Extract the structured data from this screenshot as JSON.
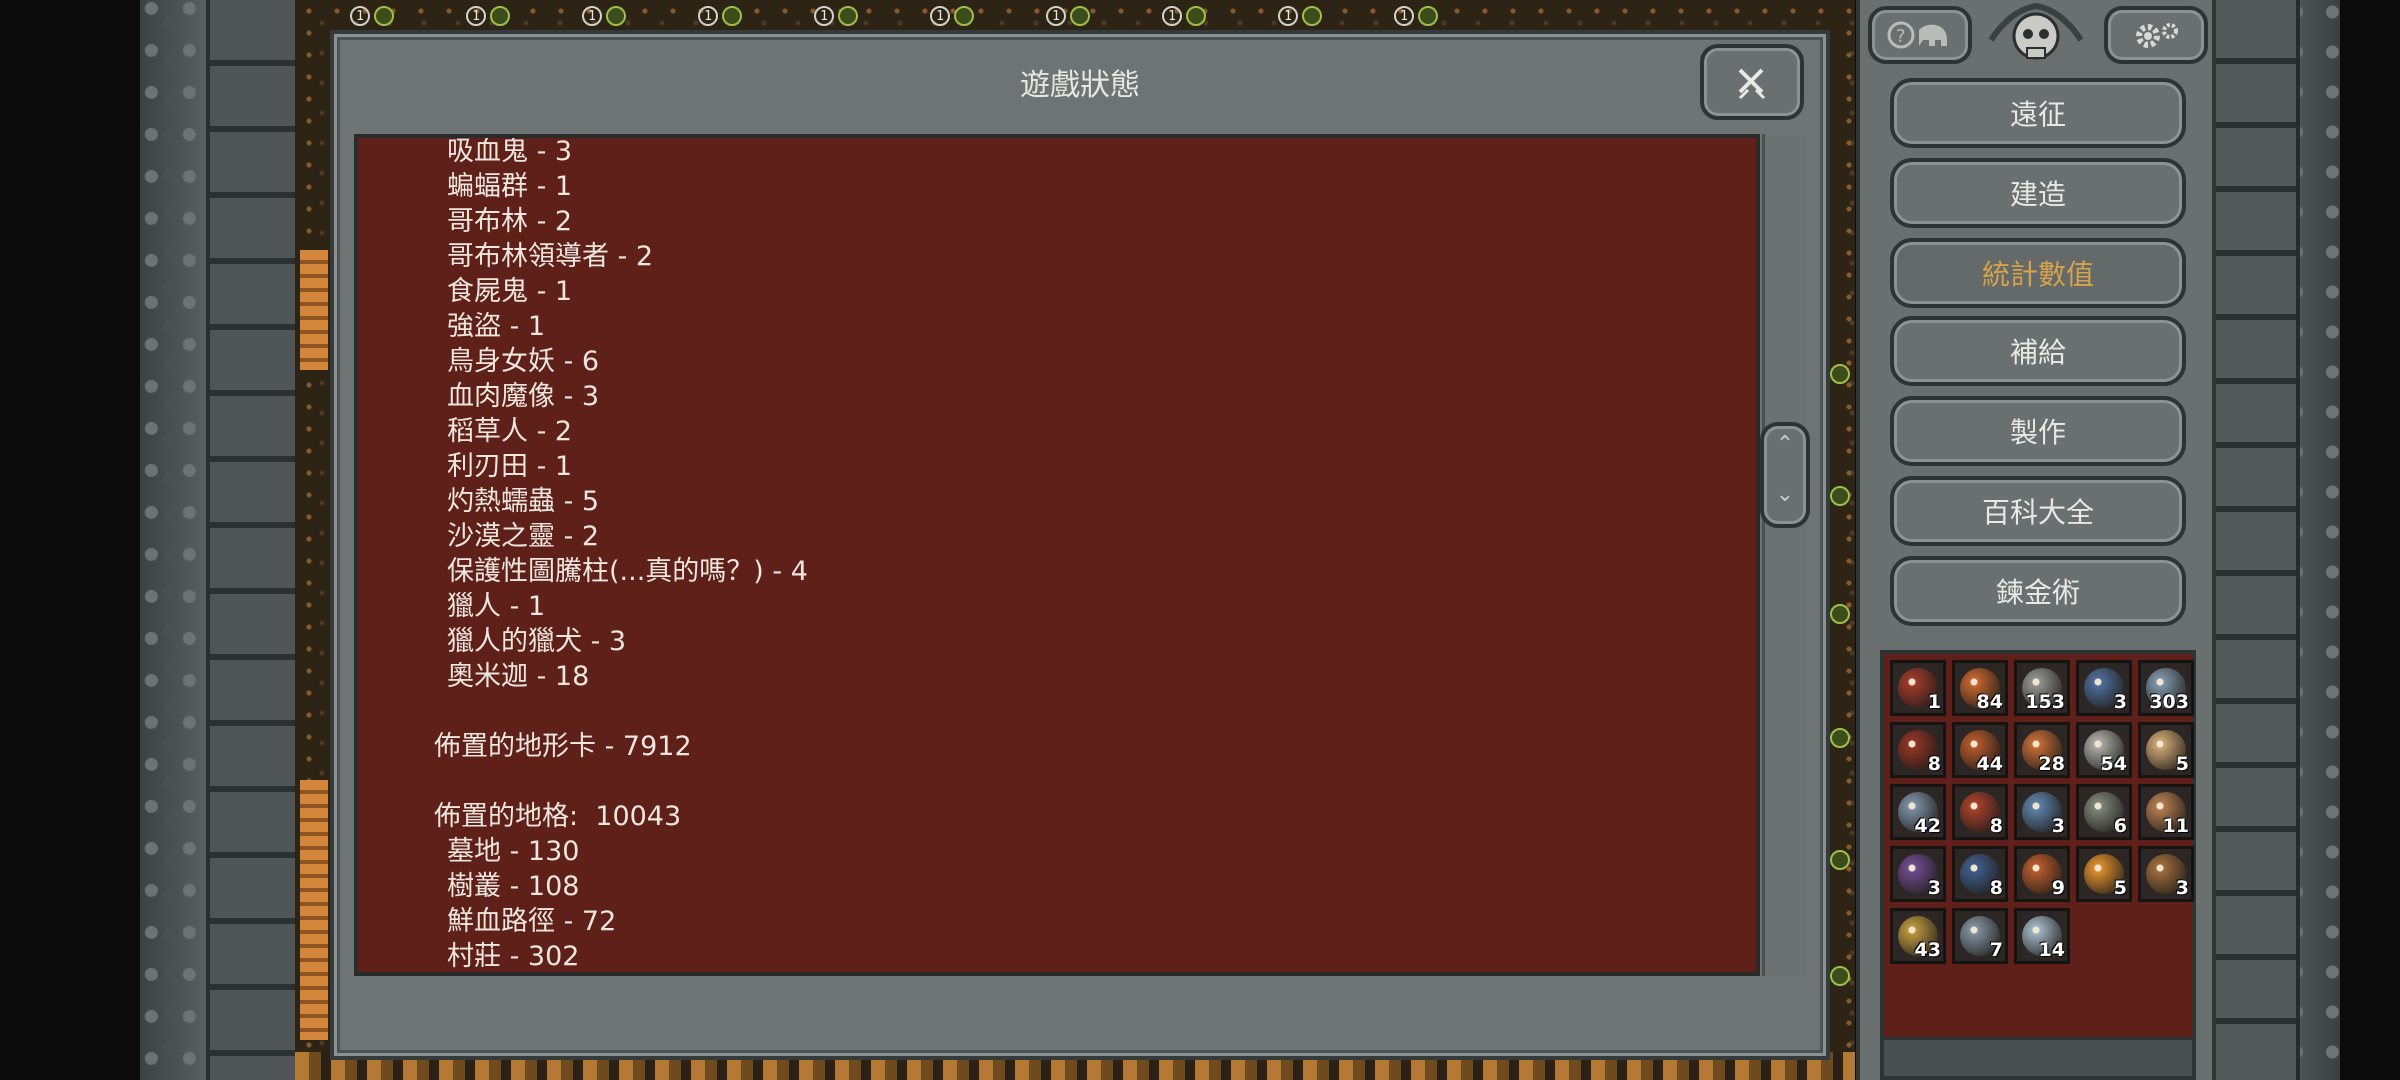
{
  "dialog": {
    "title": "遊戲狀態",
    "close_icon": "close-swords-icon"
  },
  "stats_lines": [
    {
      "kind": "item",
      "text": "吸血鬼 - 3"
    },
    {
      "kind": "item",
      "text": "蝙蝠群 - 1"
    },
    {
      "kind": "item",
      "text": "哥布林 - 2"
    },
    {
      "kind": "item",
      "text": "哥布林領導者 - 2"
    },
    {
      "kind": "item",
      "text": "食屍鬼 - 1"
    },
    {
      "kind": "item",
      "text": "強盜 - 1"
    },
    {
      "kind": "item",
      "text": "鳥身女妖 - 6"
    },
    {
      "kind": "item",
      "text": "血肉魔像 - 3"
    },
    {
      "kind": "item",
      "text": "稻草人 - 2"
    },
    {
      "kind": "item",
      "text": "利刃田 - 1"
    },
    {
      "kind": "item",
      "text": "灼熱蠕蟲 - 5"
    },
    {
      "kind": "item",
      "text": "沙漠之靈 - 2"
    },
    {
      "kind": "item",
      "text": "保護性圖騰柱(...真的嗎？) - 4"
    },
    {
      "kind": "item",
      "text": "獵人 - 1"
    },
    {
      "kind": "item",
      "text": "獵人的獵犬 - 3"
    },
    {
      "kind": "item",
      "text": "奧米迦 - 18"
    },
    {
      "kind": "blank",
      "text": ""
    },
    {
      "kind": "heading",
      "text": "佈置的地形卡 - 7912"
    },
    {
      "kind": "blank",
      "text": ""
    },
    {
      "kind": "heading",
      "text": "佈置的地格:  10043"
    },
    {
      "kind": "item",
      "text": "墓地 - 130"
    },
    {
      "kind": "item",
      "text": "樹叢 - 108"
    },
    {
      "kind": "item",
      "text": "鮮血路徑 - 72"
    },
    {
      "kind": "item",
      "text": "村莊 - 302"
    }
  ],
  "scroll": {
    "up_icon": "chevron-up-icon",
    "down_icon": "chevron-down-icon"
  },
  "menu": {
    "top_left_icon": "help-elephant-icon",
    "top_right_icon": "gears-icon",
    "emblem_icon": "skull-emblem-icon",
    "buttons": [
      {
        "label": "遠征",
        "active": false
      },
      {
        "label": "建造",
        "active": false
      },
      {
        "label": "統計數值",
        "active": true
      },
      {
        "label": "補給",
        "active": false
      },
      {
        "label": "製作",
        "active": false
      },
      {
        "label": "百科大全",
        "active": false
      },
      {
        "label": "鍊金術",
        "active": false
      }
    ],
    "active_color": "#d8a24a"
  },
  "inventory": [
    {
      "count": "1",
      "icon": "crossbow-icon",
      "color": "#9c3a2a"
    },
    {
      "count": "84",
      "icon": "scroll-icon",
      "color": "#c0632e"
    },
    {
      "count": "153",
      "icon": "stone-icon",
      "color": "#8f928c"
    },
    {
      "count": "3",
      "icon": "blue-blade-icon",
      "color": "#4d6c96"
    },
    {
      "count": "303",
      "icon": "metal-orb-icon",
      "color": "#7c93a8"
    },
    {
      "count": "8",
      "icon": "red-bow-icon",
      "color": "#8e3524"
    },
    {
      "count": "44",
      "icon": "wood-icon",
      "color": "#b0582a"
    },
    {
      "count": "28",
      "icon": "clock-icon",
      "color": "#c06a34"
    },
    {
      "count": "54",
      "icon": "skull-icon",
      "color": "#a7a9a2"
    },
    {
      "count": "5",
      "icon": "parchment-icon",
      "color": "#c9a472"
    },
    {
      "count": "42",
      "icon": "eye-book-icon",
      "color": "#7a8ea0"
    },
    {
      "count": "8",
      "icon": "red-shard-icon",
      "color": "#a2402a"
    },
    {
      "count": "3",
      "icon": "blue-orb-icon",
      "color": "#5b7fa4"
    },
    {
      "count": "6",
      "icon": "claw-icon",
      "color": "#7c8478"
    },
    {
      "count": "11",
      "icon": "rope-icon",
      "color": "#b07a4e"
    },
    {
      "count": "3",
      "icon": "thorn-icon",
      "color": "#6d4a8a"
    },
    {
      "count": "8",
      "icon": "dark-orb-icon",
      "color": "#3f5c86"
    },
    {
      "count": "9",
      "icon": "flame-axe-icon",
      "color": "#b45a2c"
    },
    {
      "count": "5",
      "icon": "golden-orb-icon",
      "color": "#d88c2e"
    },
    {
      "count": "3",
      "icon": "coil-icon",
      "color": "#9c6a3a"
    },
    {
      "count": "43",
      "icon": "gold-nugget-icon",
      "color": "#b8963e"
    },
    {
      "count": "7",
      "icon": "steel-coil-icon",
      "color": "#7f8f9c"
    },
    {
      "count": "14",
      "icon": "crystal-skull-icon",
      "color": "#9db2bf"
    }
  ],
  "background": {
    "top_badge_number": "1",
    "top_badge_count": 10
  }
}
